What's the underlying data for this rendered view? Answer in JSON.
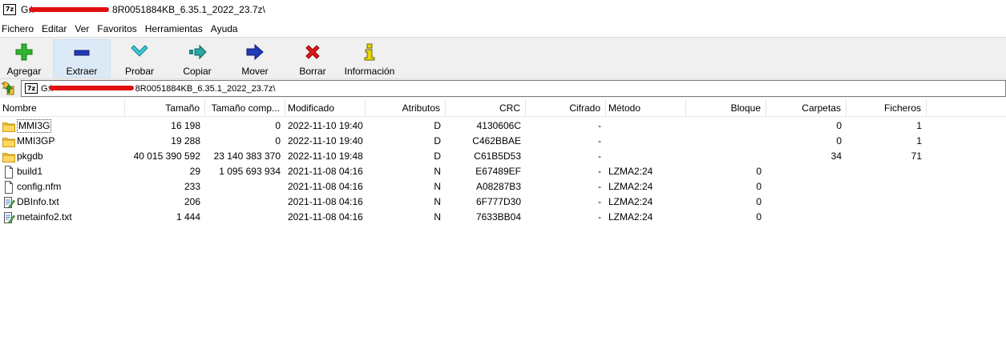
{
  "window": {
    "app_icon": "7z",
    "title_prefix": "G:\\",
    "title_suffix": "8R0051884KB_6.35.1_2022_23.7z\\"
  },
  "menu": [
    "Fichero",
    "Editar",
    "Ver",
    "Favoritos",
    "Herramientas",
    "Ayuda"
  ],
  "toolbar": [
    {
      "label": "Agregar",
      "icon": "plus-icon",
      "color": "#1fa01f"
    },
    {
      "label": "Extraer",
      "icon": "minus-icon",
      "color": "#1a2fa8"
    },
    {
      "label": "Probar",
      "icon": "check-arrow-icon",
      "color": "#2bb6c9"
    },
    {
      "label": "Copiar",
      "icon": "double-arrow-icon",
      "color": "#1e8a8a"
    },
    {
      "label": "Mover",
      "icon": "arrow-right-icon",
      "color": "#1a2fa8"
    },
    {
      "label": "Borrar",
      "icon": "x-icon",
      "color": "#d01010"
    },
    {
      "label": "Información",
      "icon": "info-icon",
      "color": "#d8c800"
    }
  ],
  "address": {
    "prefix": "G:\\",
    "suffix": "8R0051884KB_6.35.1_2022_23.7z\\"
  },
  "columns": [
    "Nombre",
    "Tamaño",
    "Tamaño comp...",
    "Modificado",
    "Atributos",
    "CRC",
    "Cifrado",
    "Método",
    "Bloque",
    "Carpetas",
    "Ficheros"
  ],
  "rows": [
    {
      "name": "MMI3G",
      "type": "folder",
      "size": "16 198",
      "packed": "0",
      "modified": "2022-11-10 19:40",
      "attr": "D",
      "crc": "4130606C",
      "encrypted": "-",
      "method": "",
      "block": "",
      "folders": "0",
      "files": "1"
    },
    {
      "name": "MMI3GP",
      "type": "folder",
      "size": "19 288",
      "packed": "0",
      "modified": "2022-11-10 19:40",
      "attr": "D",
      "crc": "C462BBAE",
      "encrypted": "-",
      "method": "",
      "block": "",
      "folders": "0",
      "files": "1"
    },
    {
      "name": "pkgdb",
      "type": "folder",
      "size": "40 015 390 592",
      "packed": "23 140 383 370",
      "modified": "2022-11-10 19:48",
      "attr": "D",
      "crc": "C61B5D53",
      "encrypted": "-",
      "method": "",
      "block": "",
      "folders": "34",
      "files": "71"
    },
    {
      "name": "build1",
      "type": "file",
      "size": "29",
      "packed": "1 095 693 934",
      "modified": "2021-11-08 04:16",
      "attr": "N",
      "crc": "E67489EF",
      "encrypted": "-",
      "method": "LZMA2:24",
      "block": "0",
      "folders": "",
      "files": ""
    },
    {
      "name": "config.nfm",
      "type": "file",
      "size": "233",
      "packed": "",
      "modified": "2021-11-08 04:16",
      "attr": "N",
      "crc": "A08287B3",
      "encrypted": "-",
      "method": "LZMA2:24",
      "block": "0",
      "folders": "",
      "files": ""
    },
    {
      "name": "DBInfo.txt",
      "type": "textfile",
      "size": "206",
      "packed": "",
      "modified": "2021-11-08 04:16",
      "attr": "N",
      "crc": "6F777D30",
      "encrypted": "-",
      "method": "LZMA2:24",
      "block": "0",
      "folders": "",
      "files": ""
    },
    {
      "name": "metainfo2.txt",
      "type": "textfile",
      "size": "1 444",
      "packed": "",
      "modified": "2021-11-08 04:16",
      "attr": "N",
      "crc": "7633BB04",
      "encrypted": "-",
      "method": "LZMA2:24",
      "block": "0",
      "folders": "",
      "files": ""
    }
  ]
}
